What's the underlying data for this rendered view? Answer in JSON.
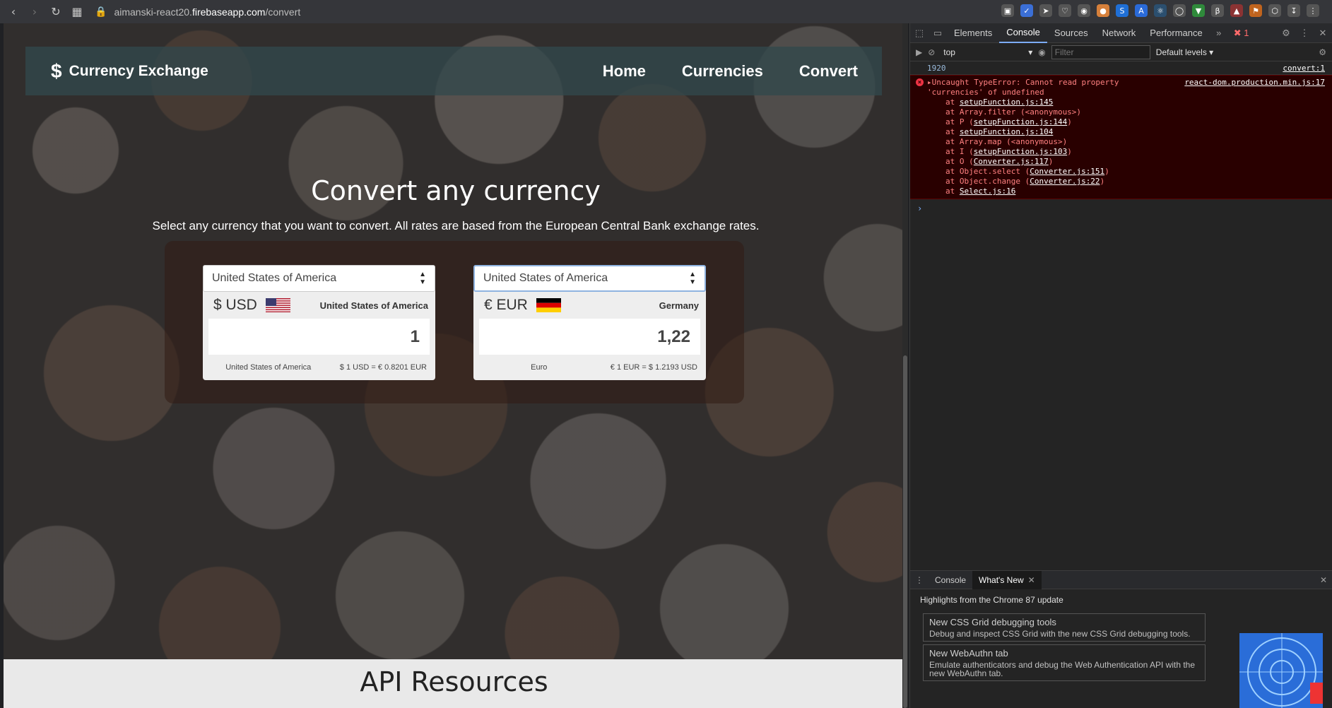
{
  "browser": {
    "url_path": "aimanski-react20.",
    "url_host": "firebaseapp.com",
    "url_rest": "/convert"
  },
  "site": {
    "brand": "Currency Exchange",
    "nav": [
      "Home",
      "Currencies",
      "Convert"
    ],
    "hero_title": "Convert any currency",
    "hero_subtitle": "Select any currency that you want to convert. All rates are based from the European Central Bank exchange rates.",
    "api_title": "API Resources"
  },
  "converter": {
    "left": {
      "select_value": "United States of America",
      "code": "$ USD",
      "country": "United States of America",
      "amount": "1",
      "currency_name": "United States of America",
      "rate": "$ 1 USD = € 0.8201 EUR"
    },
    "right": {
      "select_value": "United States of America",
      "code": "€ EUR",
      "country": "Germany",
      "amount": "1,22",
      "currency_name": "Euro",
      "rate": "€ 1 EUR = $ 1.2193 USD"
    }
  },
  "devtools": {
    "tabs": [
      "Elements",
      "Console",
      "Sources",
      "Network",
      "Performance"
    ],
    "active_tab": "Console",
    "error_count": "1",
    "context": "top",
    "filter_placeholder": "Filter",
    "levels": "Default levels",
    "log_value": "1920",
    "log_source": "convert:1",
    "error_message": "Uncaught TypeError: Cannot read property 'currencies' of undefined",
    "error_source": "react-dom.production.min.js:17",
    "stack": [
      {
        "prefix": "at ",
        "link": "setupFunction.js:145",
        "suffix": ""
      },
      {
        "prefix": "at Array.filter (<anonymous>)",
        "link": "",
        "suffix": ""
      },
      {
        "prefix": "at P (",
        "link": "setupFunction.js:144",
        "suffix": ")"
      },
      {
        "prefix": "at ",
        "link": "setupFunction.js:104",
        "suffix": ""
      },
      {
        "prefix": "at Array.map (<anonymous>)",
        "link": "",
        "suffix": ""
      },
      {
        "prefix": "at I (",
        "link": "setupFunction.js:103",
        "suffix": ")"
      },
      {
        "prefix": "at O (",
        "link": "Converter.js:117",
        "suffix": ")"
      },
      {
        "prefix": "at Object.select (",
        "link": "Converter.js:151",
        "suffix": ")"
      },
      {
        "prefix": "at Object.change (",
        "link": "Converter.js:22",
        "suffix": ")"
      },
      {
        "prefix": "at ",
        "link": "Select.js:16",
        "suffix": ""
      }
    ],
    "drawer_tabs": [
      "Console",
      "What's New"
    ],
    "drawer_highlight": "Highlights from the Chrome 87 update",
    "news": [
      {
        "title": "New CSS Grid debugging tools",
        "desc": "Debug and inspect CSS Grid with the new CSS Grid debugging tools."
      },
      {
        "title": "New WebAuthn tab",
        "desc": "Emulate authenticators and debug the Web Authentication API with the new WebAuthn tab."
      }
    ]
  }
}
